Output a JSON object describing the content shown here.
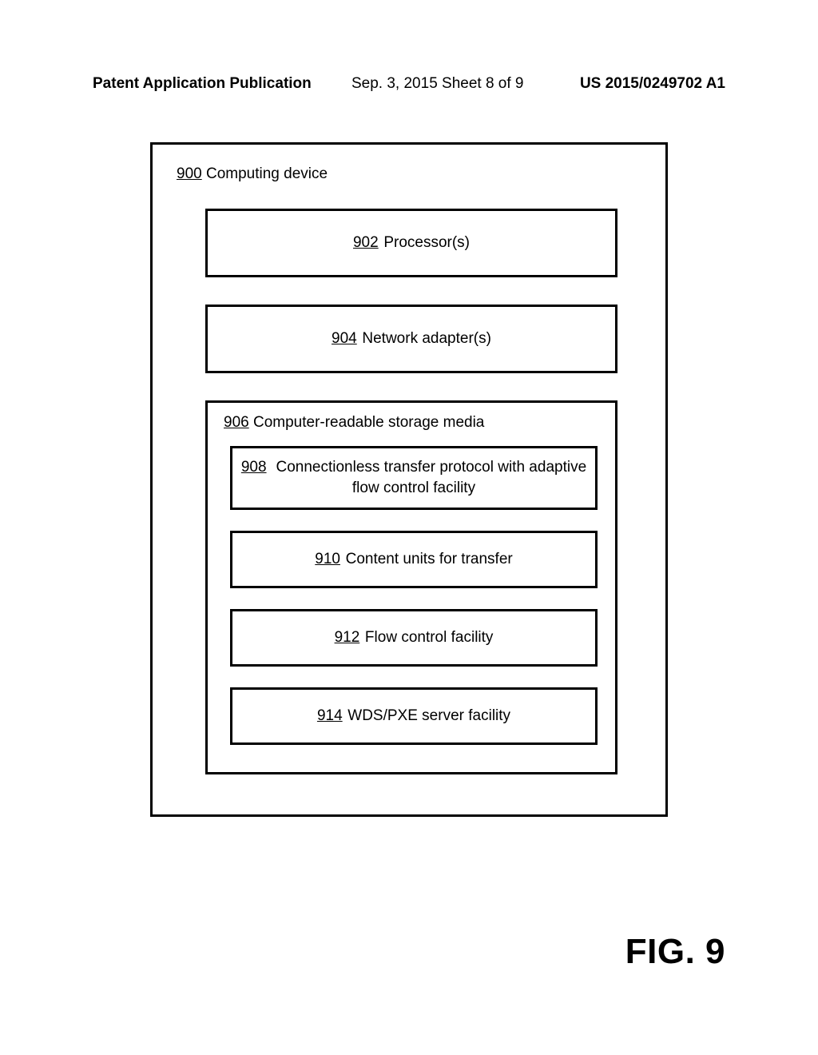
{
  "header": {
    "left": "Patent Application Publication",
    "center": "Sep. 3, 2015   Sheet 8 of 9",
    "right": "US 2015/0249702 A1"
  },
  "outer": {
    "num": "900",
    "label": "Computing device"
  },
  "processors": {
    "num": "902",
    "label": "Processor(s)"
  },
  "network": {
    "num": "904",
    "label": "Network adapter(s)"
  },
  "storage": {
    "num": "906",
    "label": "Computer-readable storage media",
    "items": {
      "b908": {
        "num": "908",
        "label": "Connectionless transfer protocol with adaptive flow control facility"
      },
      "b910": {
        "num": "910",
        "label": "Content units for transfer"
      },
      "b912": {
        "num": "912",
        "label": "Flow control facility"
      },
      "b914": {
        "num": "914",
        "label": "WDS/PXE server facility"
      }
    }
  },
  "figure_label": "FIG. 9"
}
